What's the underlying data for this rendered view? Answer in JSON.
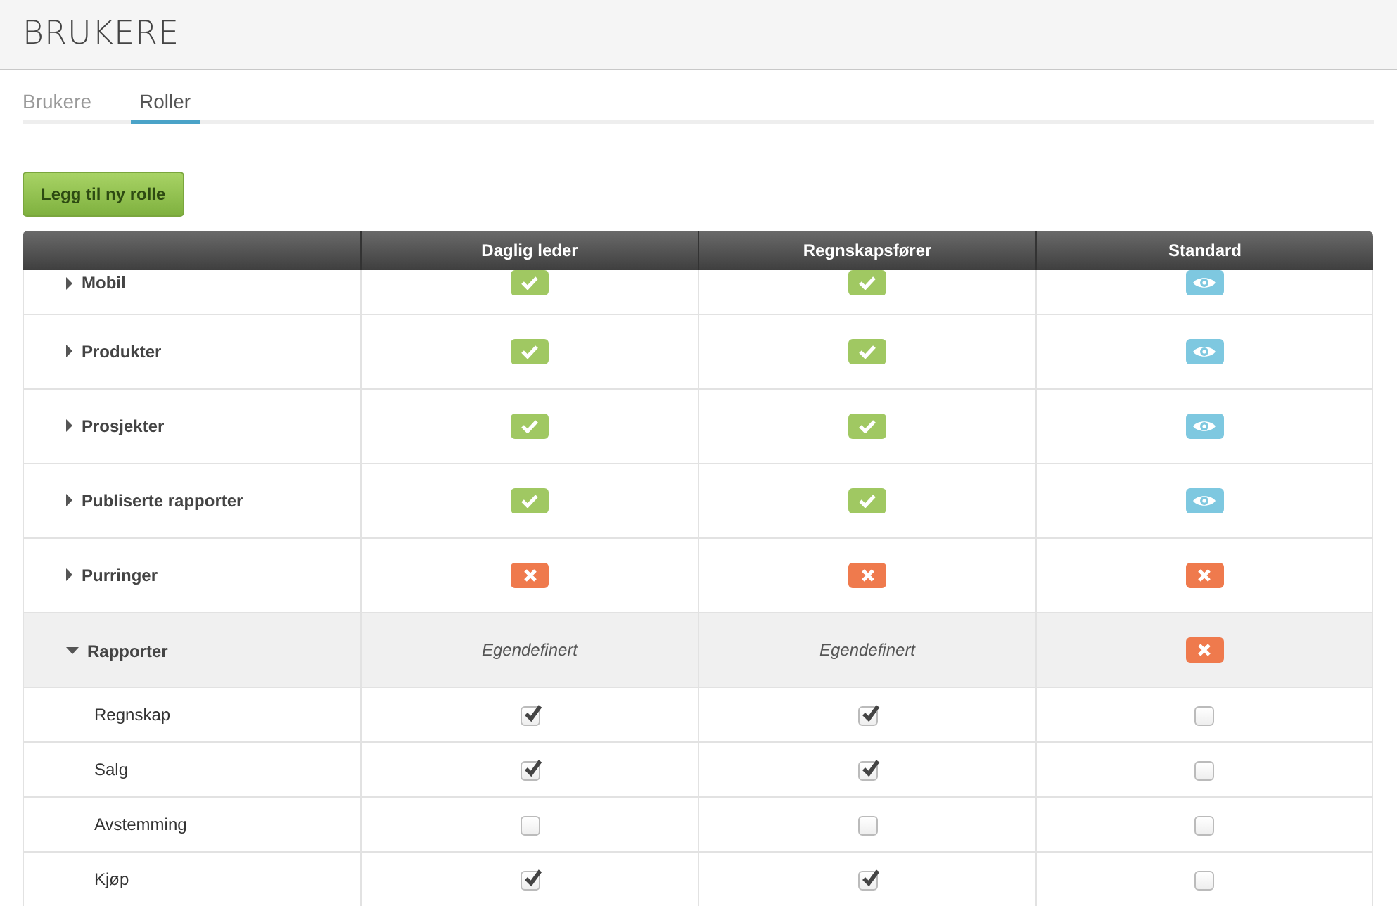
{
  "page_title": "BRUKERE",
  "tabs": [
    {
      "label": "Brukere",
      "selected": false
    },
    {
      "label": "Roller",
      "selected": true
    }
  ],
  "add_button": "Legg til ny rolle",
  "table": {
    "columns": [
      "Daglig leder",
      "Regnskapsfører",
      "Standard"
    ],
    "rows": [
      {
        "label": "Mobil",
        "expanded": false,
        "cells": [
          {
            "kind": "allow"
          },
          {
            "kind": "allow"
          },
          {
            "kind": "view"
          }
        ]
      },
      {
        "label": "Produkter",
        "expanded": false,
        "cells": [
          {
            "kind": "allow"
          },
          {
            "kind": "allow"
          },
          {
            "kind": "view"
          }
        ]
      },
      {
        "label": "Prosjekter",
        "expanded": false,
        "cells": [
          {
            "kind": "allow"
          },
          {
            "kind": "allow"
          },
          {
            "kind": "view"
          }
        ]
      },
      {
        "label": "Publiserte rapporter",
        "expanded": false,
        "cells": [
          {
            "kind": "allow"
          },
          {
            "kind": "allow"
          },
          {
            "kind": "view"
          }
        ]
      },
      {
        "label": "Purringer",
        "expanded": false,
        "cells": [
          {
            "kind": "deny"
          },
          {
            "kind": "deny"
          },
          {
            "kind": "deny"
          }
        ]
      },
      {
        "label": "Rapporter",
        "expanded": true,
        "cells": [
          {
            "kind": "custom",
            "text": "Egendefinert"
          },
          {
            "kind": "custom",
            "text": "Egendefinert"
          },
          {
            "kind": "deny"
          }
        ],
        "children": [
          {
            "label": "Regnskap",
            "checks": [
              true,
              true,
              false
            ]
          },
          {
            "label": "Salg",
            "checks": [
              true,
              true,
              false
            ]
          },
          {
            "label": "Avstemming",
            "checks": [
              false,
              false,
              false
            ]
          },
          {
            "label": "Kjøp",
            "checks": [
              true,
              true,
              false
            ]
          }
        ]
      }
    ]
  }
}
